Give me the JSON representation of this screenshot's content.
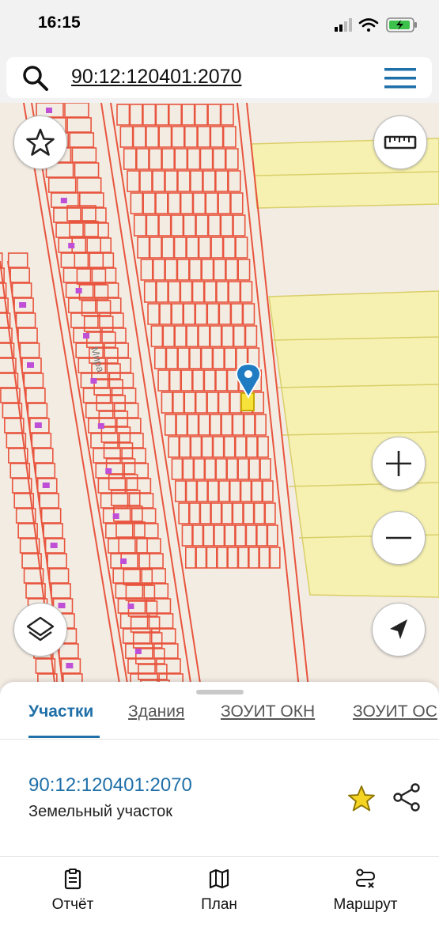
{
  "status_bar": {
    "time": "16:15"
  },
  "search": {
    "query": "90:12:120401:2070"
  },
  "map": {
    "street_label": "Мира",
    "parcel_color": "#e8553e",
    "building_color": "#c04fd8",
    "zone_color": "#f4efae",
    "pin_color": "#1f7cc2"
  },
  "tabs": [
    {
      "label": "Участки",
      "active": true
    },
    {
      "label": "Здания",
      "active": false
    },
    {
      "label": "ЗОУИТ ОКН",
      "active": false
    },
    {
      "label": "ЗОУИТ ОС",
      "active": false
    }
  ],
  "parcel": {
    "number": "90:12:120401:2070",
    "type": "Земельный участок"
  },
  "bottom_nav": [
    {
      "label": "Отчёт",
      "icon": "report-icon"
    },
    {
      "label": "План",
      "icon": "map-plan-icon"
    },
    {
      "label": "Маршрут",
      "icon": "route-icon"
    }
  ],
  "accent_color": "#1f6fa8"
}
